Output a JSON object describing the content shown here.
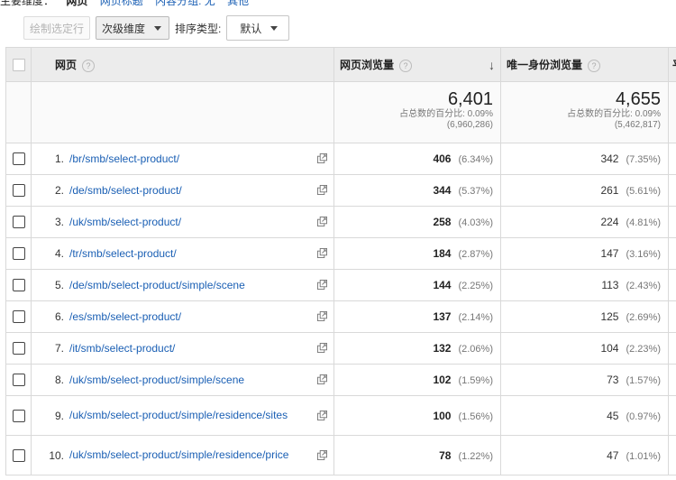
{
  "top_bar": {
    "label": "主要维度：",
    "current": "网页",
    "links": [
      "网页标题",
      "内容分组: 无",
      "其他"
    ]
  },
  "toolbar": {
    "plot_rows_label": "绘制选定行",
    "secondary_dimension_label": "次级维度",
    "sort_type_label": "排序类型:",
    "sort_value": "默认"
  },
  "table": {
    "columns": {
      "page": "网页",
      "pageviews": "网页浏览量",
      "unique_pageviews": "唯一身份浏览量",
      "next_partial": "平"
    },
    "totals": {
      "pageviews": {
        "value": "6,401",
        "pct_label": "占总数的百分比: 0.09%",
        "overall": "(6,960,286)"
      },
      "unique_pageviews": {
        "value": "4,655",
        "pct_label": "占总数的百分比: 0.09%",
        "overall": "(5,462,817)"
      }
    },
    "rows": [
      {
        "index": "1.",
        "page": "/br/smb/select-product/",
        "pageviews": "406",
        "pv_pct": "(6.34%)",
        "unique": "342",
        "u_pct": "(7.35%)"
      },
      {
        "index": "2.",
        "page": "/de/smb/select-product/",
        "pageviews": "344",
        "pv_pct": "(5.37%)",
        "unique": "261",
        "u_pct": "(5.61%)"
      },
      {
        "index": "3.",
        "page": "/uk/smb/select-product/",
        "pageviews": "258",
        "pv_pct": "(4.03%)",
        "unique": "224",
        "u_pct": "(4.81%)"
      },
      {
        "index": "4.",
        "page": "/tr/smb/select-product/",
        "pageviews": "184",
        "pv_pct": "(2.87%)",
        "unique": "147",
        "u_pct": "(3.16%)"
      },
      {
        "index": "5.",
        "page": "/de/smb/select-product/simple/scene",
        "pageviews": "144",
        "pv_pct": "(2.25%)",
        "unique": "113",
        "u_pct": "(2.43%)"
      },
      {
        "index": "6.",
        "page": "/es/smb/select-product/",
        "pageviews": "137",
        "pv_pct": "(2.14%)",
        "unique": "125",
        "u_pct": "(2.69%)"
      },
      {
        "index": "7.",
        "page": "/it/smb/select-product/",
        "pageviews": "132",
        "pv_pct": "(2.06%)",
        "unique": "104",
        "u_pct": "(2.23%)"
      },
      {
        "index": "8.",
        "page": "/uk/smb/select-product/simple/scene",
        "pageviews": "102",
        "pv_pct": "(1.59%)",
        "unique": "73",
        "u_pct": "(1.57%)"
      },
      {
        "index": "9.",
        "page": "/uk/smb/select-product/simple/residence/sites",
        "pageviews": "100",
        "pv_pct": "(1.56%)",
        "unique": "45",
        "u_pct": "(0.97%)"
      },
      {
        "index": "10.",
        "page": "/uk/smb/select-product/simple/residence/price",
        "pageviews": "78",
        "pv_pct": "(1.22%)",
        "unique": "47",
        "u_pct": "(1.01%)"
      }
    ]
  },
  "icons": {
    "help": "help-circle-icon",
    "sort": "arrow-down-icon",
    "external": "open-in-new-window-icon",
    "dropdown": "caret-down-icon"
  },
  "colors": {
    "link": "#1a5fb4",
    "header_bg": "#ececec",
    "border": "#d9d9d9"
  }
}
